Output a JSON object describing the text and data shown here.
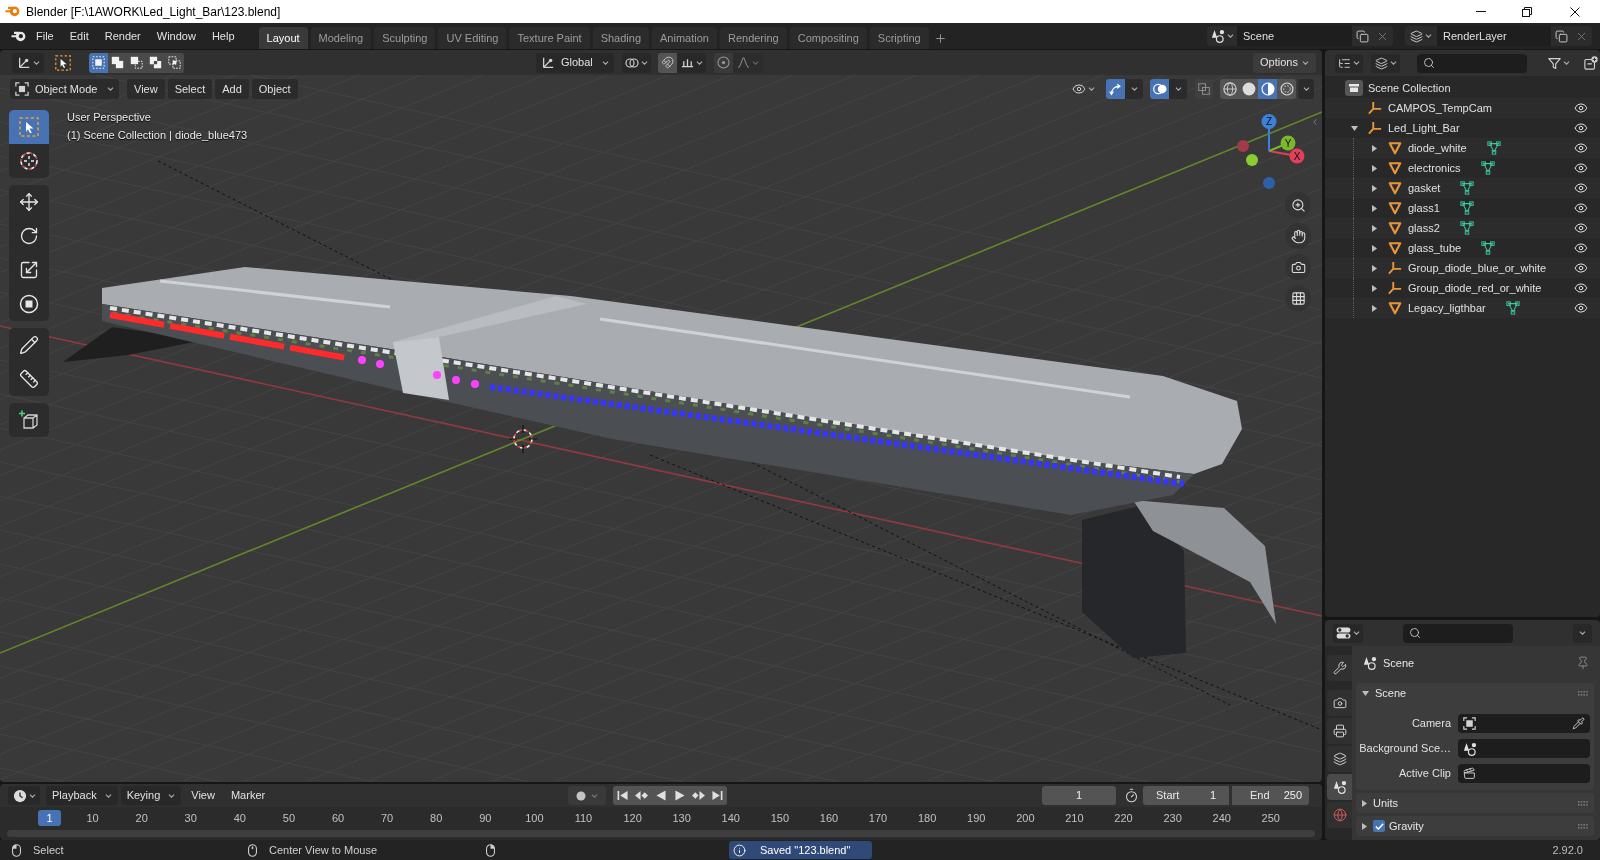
{
  "window": {
    "title": "Blender [F:\\1AWORK\\Led_Light_Bar\\123.blend]"
  },
  "top_bar": {
    "menus": [
      "File",
      "Edit",
      "Render",
      "Window",
      "Help"
    ],
    "workspaces": [
      {
        "label": "Layout",
        "selected": true
      },
      {
        "label": "Modeling",
        "selected": false
      },
      {
        "label": "Sculpting",
        "selected": false
      },
      {
        "label": "UV Editing",
        "selected": false
      },
      {
        "label": "Texture Paint",
        "selected": false
      },
      {
        "label": "Shading",
        "selected": false
      },
      {
        "label": "Animation",
        "selected": false
      },
      {
        "label": "Rendering",
        "selected": false
      },
      {
        "label": "Compositing",
        "selected": false
      },
      {
        "label": "Scripting",
        "selected": false
      }
    ],
    "scene": "Scene",
    "view_layer": "RenderLayer"
  },
  "tool_header": {
    "select_modes": [
      {
        "kind": "set",
        "selected": true
      },
      {
        "kind": "extend",
        "selected": false
      },
      {
        "kind": "subtract",
        "selected": false
      },
      {
        "kind": "invert",
        "selected": false
      },
      {
        "kind": "intersect",
        "selected": false
      }
    ],
    "orientation": "Global",
    "snap": {
      "on": false
    },
    "proportional_editing": {
      "on": false
    },
    "options": "Options"
  },
  "viewport_header": {
    "mode": "Object Mode",
    "menus": [
      "View",
      "Select",
      "Add",
      "Object"
    ],
    "gizmos": {
      "on": true
    },
    "overlays": {
      "on": true
    },
    "xray": {
      "on": false
    },
    "shading": [
      {
        "kind": "wireframe",
        "selected": false
      },
      {
        "kind": "solid",
        "selected": false
      },
      {
        "kind": "material",
        "selected": true
      },
      {
        "kind": "rendered",
        "selected": false
      }
    ]
  },
  "viewport": {
    "view_name": "User Perspective",
    "context": "(1) Scene Collection | diode_blue473",
    "tool_groups": [
      [
        {
          "kind": "select_box",
          "selected": true
        },
        {
          "kind": "cursor",
          "selected": false
        }
      ],
      [
        {
          "kind": "move",
          "selected": false
        },
        {
          "kind": "rotate",
          "selected": false
        },
        {
          "kind": "scale",
          "selected": false
        },
        {
          "kind": "transform",
          "selected": false
        }
      ],
      [
        {
          "kind": "annotate",
          "selected": false
        },
        {
          "kind": "measure",
          "selected": false
        }
      ],
      [
        {
          "kind": "add_cube",
          "selected": false
        }
      ]
    ],
    "gizmo": {
      "x": "X",
      "y": "Y",
      "z": "Z"
    }
  },
  "timeline": {
    "menus": [
      {
        "label": "Playback",
        "kind": "dropdown"
      },
      {
        "label": "Keying",
        "kind": "dropdown"
      },
      {
        "label": "View",
        "kind": "menu"
      },
      {
        "label": "Marker",
        "kind": "menu"
      }
    ],
    "auto_keying": {
      "on": false
    },
    "playback_controls": [
      {
        "kind": "jump_start"
      },
      {
        "kind": "previous_keyframe"
      },
      {
        "kind": "play_reverse"
      },
      {
        "kind": "play"
      },
      {
        "kind": "next_keyframe"
      },
      {
        "kind": "jump_end"
      }
    ],
    "current_frame": "1",
    "start_label": "Start",
    "start": "1",
    "end_label": "End",
    "end": "250",
    "playhead": "1",
    "ruler": [
      "10",
      "20",
      "30",
      "40",
      "50",
      "60",
      "70",
      "80",
      "90",
      "100",
      "110",
      "120",
      "130",
      "140",
      "150",
      "160",
      "170",
      "180",
      "190",
      "200",
      "210",
      "220",
      "230",
      "240",
      "250"
    ]
  },
  "outliner": {
    "root": "Scene Collection",
    "items": [
      {
        "label": "CAMPOS_TempCam",
        "kind": "empty",
        "visible": true
      },
      {
        "label": "Led_Light_Bar",
        "kind": "empty",
        "expanded": true,
        "visible": true,
        "children": [
          {
            "label": "diode_white",
            "kind": "mesh",
            "expanded": false,
            "visible": true
          },
          {
            "label": "electronics",
            "kind": "mesh",
            "expanded": false,
            "visible": true
          },
          {
            "label": "gasket",
            "kind": "mesh",
            "expanded": false,
            "visible": true
          },
          {
            "label": "glass1",
            "kind": "mesh",
            "expanded": false,
            "visible": true
          },
          {
            "label": "glass2",
            "kind": "mesh",
            "expanded": false,
            "visible": true
          },
          {
            "label": "glass_tube",
            "kind": "mesh",
            "expanded": false,
            "visible": true
          },
          {
            "label": "Group_diode_blue_or_white",
            "kind": "empty",
            "expanded": false,
            "visible": true
          },
          {
            "label": "Group_diode_red_or_white",
            "kind": "empty",
            "expanded": false,
            "visible": true
          },
          {
            "label": "Legacy_ligthbar",
            "kind": "mesh",
            "expanded": false,
            "visible": true
          }
        ]
      }
    ]
  },
  "properties": {
    "tabs": [
      {
        "kind": "tool",
        "selected": false
      },
      {
        "kind": "render",
        "selected": false
      },
      {
        "kind": "output",
        "selected": false
      },
      {
        "kind": "view_layer",
        "selected": false
      },
      {
        "kind": "scene",
        "selected": true
      },
      {
        "kind": "world",
        "selected": false
      }
    ],
    "context": "Scene",
    "panels": [
      {
        "title": "Scene",
        "expanded": true,
        "fields": [
          {
            "kind": "camera",
            "label": "Camera"
          },
          {
            "kind": "scene",
            "label": "Background Sce…"
          },
          {
            "kind": "clip",
            "label": "Active Clip"
          }
        ]
      },
      {
        "title": "Units",
        "expanded": false
      },
      {
        "title": "Gravity",
        "expanded": false,
        "checked": true
      }
    ]
  },
  "status_bar": {
    "hints": [
      {
        "kind": "left",
        "label": "Select"
      },
      {
        "kind": "middle",
        "label": "Center View to Mouse"
      },
      {
        "kind": "right"
      }
    ],
    "message": "Saved \"123.blend\"",
    "version": "2.92.0"
  }
}
